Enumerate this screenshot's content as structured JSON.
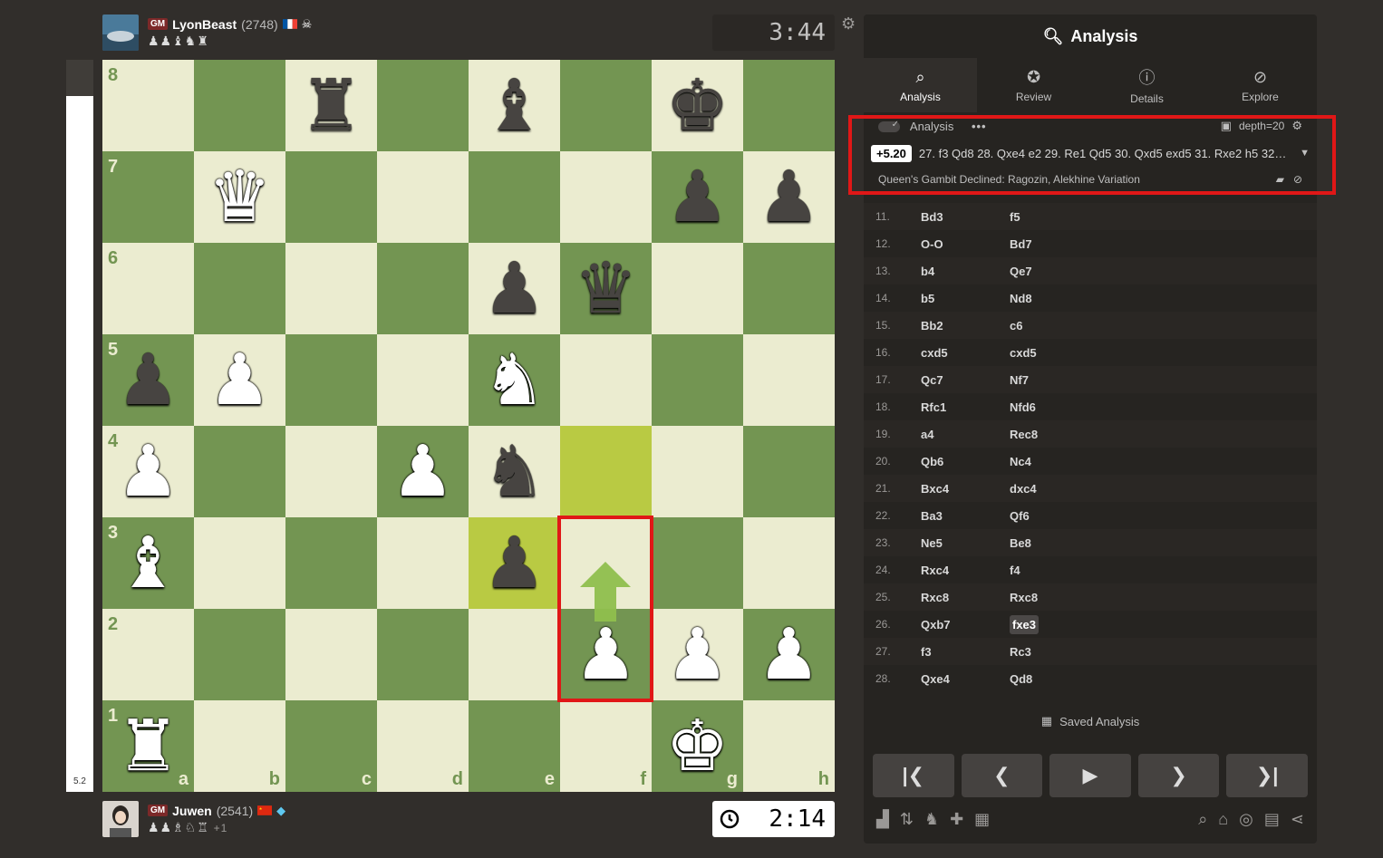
{
  "top_player": {
    "title": "GM",
    "name": "LyonBeast",
    "rating": "(2748)",
    "captured": "♟♟♝♞♜",
    "avatar_icon": "avatar-car-icon"
  },
  "bottom_player": {
    "title": "GM",
    "name": "Juwen",
    "rating": "(2541)",
    "captured": "♟♟♗♘♖",
    "plus": "+1",
    "avatar_icon": "avatar-person-icon"
  },
  "clocks": {
    "top": "3:44",
    "bottom": "2:14"
  },
  "eval_bar": {
    "label": "5.2",
    "white_fraction": 0.95
  },
  "board": {
    "ranks": [
      "8",
      "7",
      "6",
      "5",
      "4",
      "3",
      "2",
      "1"
    ],
    "files": [
      "a",
      "b",
      "c",
      "d",
      "e",
      "f",
      "g",
      "h"
    ],
    "position": [
      [
        "",
        "",
        "br",
        "",
        "bb",
        "",
        "bk",
        ""
      ],
      [
        "",
        "wq",
        "",
        "",
        "",
        "",
        "bp",
        "bp"
      ],
      [
        "",
        "",
        "",
        "",
        "bp",
        "bq",
        "",
        ""
      ],
      [
        "bp",
        "wp",
        "",
        "",
        "wn",
        "",
        "",
        ""
      ],
      [
        "wp",
        "",
        "",
        "wp",
        "bn",
        "hl",
        "",
        ""
      ],
      [
        "wb",
        "",
        "",
        "",
        "bp_hl",
        "",
        "",
        ""
      ],
      [
        "",
        "",
        "",
        "",
        "",
        "wp",
        "wp",
        "wp"
      ],
      [
        "wr",
        "",
        "",
        "",
        "",
        "",
        "wk",
        ""
      ]
    ]
  },
  "panel": {
    "title": "Analysis",
    "tabs": [
      {
        "label": "Analysis",
        "icon": "analysis-icon",
        "active": true
      },
      {
        "label": "Review",
        "icon": "star-icon",
        "active": false
      },
      {
        "label": "Details",
        "icon": "info-icon",
        "active": false
      },
      {
        "label": "Explore",
        "icon": "compass-icon",
        "active": false
      }
    ],
    "engine": {
      "label": "Analysis",
      "more": "•••",
      "depth": "depth=20",
      "eval": "+5.20",
      "line": "27. f3 Qd8 28. Qxe4 e2 29. Re1 Qd5 30. Qxd5 exd5 31. Rxe2 h5 32.…",
      "opening": "Queen's Gambit Declined: Ragozin, Alekhine Variation"
    },
    "moves": [
      {
        "n": "11.",
        "w": "Bd3",
        "b": "f5"
      },
      {
        "n": "12.",
        "w": "O-O",
        "b": "Bd7"
      },
      {
        "n": "13.",
        "w": "b4",
        "b": "Qe7"
      },
      {
        "n": "14.",
        "w": "b5",
        "b": "Nd8"
      },
      {
        "n": "15.",
        "w": "Bb2",
        "b": "c6"
      },
      {
        "n": "16.",
        "w": "cxd5",
        "b": "cxd5"
      },
      {
        "n": "17.",
        "w": "Qc7",
        "b": "Nf7"
      },
      {
        "n": "18.",
        "w": "Rfc1",
        "b": "Nfd6"
      },
      {
        "n": "19.",
        "w": "a4",
        "b": "Rec8"
      },
      {
        "n": "20.",
        "w": "Qb6",
        "b": "Nc4"
      },
      {
        "n": "21.",
        "w": "Bxc4",
        "b": "dxc4"
      },
      {
        "n": "22.",
        "w": "Ba3",
        "b": "Qf6"
      },
      {
        "n": "23.",
        "w": "Ne5",
        "b": "Be8"
      },
      {
        "n": "24.",
        "w": "Rxc4",
        "b": "f4"
      },
      {
        "n": "25.",
        "w": "Rxc8",
        "b": "Rxc8"
      },
      {
        "n": "26.",
        "w": "Qxb7",
        "b": "fxe3"
      },
      {
        "n": "27.",
        "w": "f3",
        "b": "Rc3"
      },
      {
        "n": "28.",
        "w": "Qxe4",
        "b": "Qd8"
      }
    ],
    "current_move_index": 15,
    "saved_label": "Saved Analysis"
  },
  "colors": {
    "light_square": "#ebecd0",
    "dark_square": "#739552",
    "highlight": "#b9ca43",
    "arrow": "#8fbf4d",
    "annotation_box": "#e01717"
  }
}
